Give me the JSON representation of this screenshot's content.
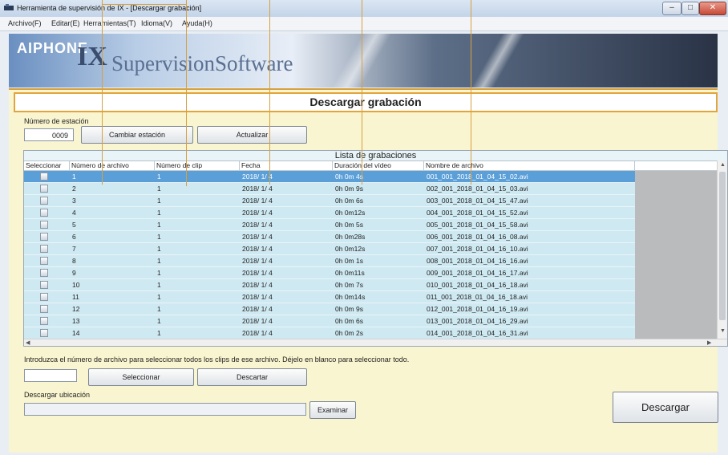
{
  "window": {
    "title": "Herramienta de supervisión de IX - [Descargar grabación]",
    "minimize_glyph": "–",
    "maximize_glyph": "□",
    "close_glyph": "✕"
  },
  "menu": [
    {
      "label": "Archivo(F)"
    },
    {
      "label": "Editar(E)"
    },
    {
      "label": "Herramientas(T)"
    },
    {
      "label": "Idioma(V)"
    },
    {
      "label": "Ayuda(H)"
    }
  ],
  "banner": {
    "brand": "AIPHONE",
    "ix": "IX",
    "product": "SupervisionSoftware"
  },
  "page_title": "Descargar grabación",
  "station": {
    "label": "Número de estación",
    "value": "0009",
    "change_button": "Cambiar estación",
    "refresh_button": "Actualizar"
  },
  "table": {
    "caption": "Lista de grabaciones",
    "columns": [
      "Seleccionar",
      "Número de archivo",
      "Número de clip",
      "Fecha",
      "Duración del vídeo",
      "Nombre de archivo"
    ],
    "rows": [
      {
        "file_no": "1",
        "clip_no": "1",
        "date": "2018/ 1/ 4",
        "duration": "0h 0m 4s",
        "name": "001_001_2018_01_04_15_02.avi"
      },
      {
        "file_no": "2",
        "clip_no": "1",
        "date": "2018/ 1/ 4",
        "duration": "0h 0m 9s",
        "name": "002_001_2018_01_04_15_03.avi"
      },
      {
        "file_no": "3",
        "clip_no": "1",
        "date": "2018/ 1/ 4",
        "duration": "0h 0m 6s",
        "name": "003_001_2018_01_04_15_47.avi"
      },
      {
        "file_no": "4",
        "clip_no": "1",
        "date": "2018/ 1/ 4",
        "duration": "0h 0m12s",
        "name": "004_001_2018_01_04_15_52.avi"
      },
      {
        "file_no": "5",
        "clip_no": "1",
        "date": "2018/ 1/ 4",
        "duration": "0h 0m 5s",
        "name": "005_001_2018_01_04_15_58.avi"
      },
      {
        "file_no": "6",
        "clip_no": "1",
        "date": "2018/ 1/ 4",
        "duration": "0h 0m28s",
        "name": "006_001_2018_01_04_16_08.avi"
      },
      {
        "file_no": "7",
        "clip_no": "1",
        "date": "2018/ 1/ 4",
        "duration": "0h 0m12s",
        "name": "007_001_2018_01_04_16_10.avi"
      },
      {
        "file_no": "8",
        "clip_no": "1",
        "date": "2018/ 1/ 4",
        "duration": "0h 0m 1s",
        "name": "008_001_2018_01_04_16_16.avi"
      },
      {
        "file_no": "9",
        "clip_no": "1",
        "date": "2018/ 1/ 4",
        "duration": "0h 0m11s",
        "name": "009_001_2018_01_04_16_17.avi"
      },
      {
        "file_no": "10",
        "clip_no": "1",
        "date": "2018/ 1/ 4",
        "duration": "0h 0m 7s",
        "name": "010_001_2018_01_04_16_18.avi"
      },
      {
        "file_no": "11",
        "clip_no": "1",
        "date": "2018/ 1/ 4",
        "duration": "0h 0m14s",
        "name": "011_001_2018_01_04_16_18.avi"
      },
      {
        "file_no": "12",
        "clip_no": "1",
        "date": "2018/ 1/ 4",
        "duration": "0h 0m 9s",
        "name": "012_001_2018_01_04_16_19.avi"
      },
      {
        "file_no": "13",
        "clip_no": "1",
        "date": "2018/ 1/ 4",
        "duration": "0h 0m 6s",
        "name": "013_001_2018_01_04_16_29.avi"
      },
      {
        "file_no": "14",
        "clip_no": "1",
        "date": "2018/ 1/ 4",
        "duration": "0h 0m 2s",
        "name": "014_001_2018_01_04_16_31.avi"
      }
    ]
  },
  "select": {
    "instruction": "Introduzca el número de archivo para seleccionar todos los clips de ese archivo. Déjelo en blanco para seleccionar todo.",
    "input_value": "",
    "select_button": "Seleccionar",
    "discard_button": "Descartar"
  },
  "download": {
    "location_label": "Descargar ubicación",
    "location_value": "",
    "browse_button": "Examinar",
    "download_button": "Descargar"
  }
}
